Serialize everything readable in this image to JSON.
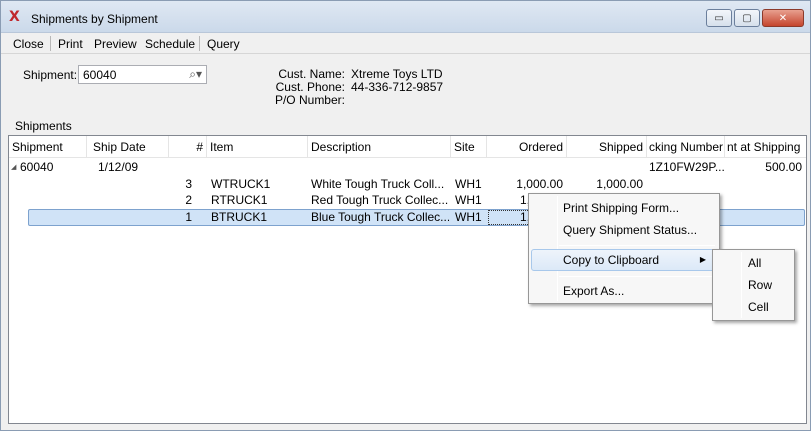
{
  "window": {
    "title": "Shipments by Shipment",
    "app_icon": "xtuple-x-icon",
    "controls": [
      "minimize-icon",
      "maximize-icon",
      "close-icon"
    ],
    "control_glyphs": {
      "minimize": "▭",
      "maximize": "▢",
      "close": "✕"
    }
  },
  "menubar": {
    "close": "Close",
    "print": "Print",
    "preview": "Preview",
    "schedule": "Schedule",
    "query": "Query"
  },
  "form": {
    "shipment_label": "Shipment:",
    "shipment_value": "60040",
    "search_icon_glyph": "⌕▾",
    "cust_name_label": "Cust. Name:",
    "cust_name_value": "Xtreme Toys LTD",
    "cust_phone_label": "Cust. Phone:",
    "cust_phone_value": "44-336-712-9857",
    "po_label": "P/O Number:",
    "po_value": ""
  },
  "grid": {
    "section_label": "Shipments",
    "headers": {
      "shipment": "Shipment",
      "ship_date": "Ship Date",
      "num": "#",
      "item": "Item",
      "description": "Description",
      "site": "Site",
      "ordered": "Ordered",
      "shipped": "Shipped",
      "tracking": "cking Number",
      "amount": "nt at Shipping"
    },
    "parent": {
      "shipment": "60040",
      "ship_date": "1/12/09",
      "tracking": "1Z10FW29P...",
      "amount": "500.00",
      "expand_glyph": "◢"
    },
    "rows": [
      {
        "num": "3",
        "item": "WTRUCK1",
        "description": "White Tough Truck Coll...",
        "site": "WH1",
        "ordered": "1,000.00",
        "shipped": "1,000.00"
      },
      {
        "num": "2",
        "item": "RTRUCK1",
        "description": "Red Tough Truck Collec...",
        "site": "WH1",
        "ordered": "1,",
        "shipped": ""
      },
      {
        "num": "1",
        "item": "BTRUCK1",
        "description": "Blue Tough Truck Collec...",
        "site": "WH1",
        "ordered": "1,",
        "shipped": ""
      }
    ]
  },
  "context_menu": {
    "print_form": "Print Shipping Form...",
    "query_status": "Query Shipment Status...",
    "copy": "Copy to Clipboard",
    "export": "Export As...",
    "submenu_glyph": "▶"
  },
  "submenu": {
    "all": "All",
    "row": "Row",
    "cell": "Cell"
  }
}
